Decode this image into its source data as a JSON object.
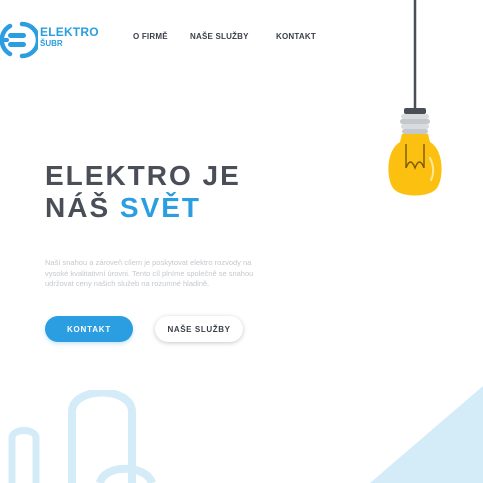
{
  "brand": {
    "line1": "ELEKTRO",
    "line2": "ŠUBR",
    "color": "#2a9ee0"
  },
  "nav": {
    "items": [
      {
        "label": "O FIRMĚ"
      },
      {
        "label": "NAŠE SLUŽBY"
      },
      {
        "label": "KONTAKT"
      }
    ]
  },
  "hero": {
    "title_part1": "ELEKTRO JE",
    "title_part2": "NÁŠ",
    "title_accent": "SVĚT",
    "description": "Naší snahou a zároveň cílem je poskytovat elektro rozvody na vysoké kvalitativní úrovni. Tento cíl plníme společně se snahou udržovat ceny našich služeb na rozumné hladině.",
    "primary_button": "KONTAKT",
    "secondary_button": "NAŠE SLUŽBY"
  },
  "icons": {
    "logo": "plug-logo-icon",
    "bulb": "light-bulb-icon",
    "plug_decoration": "plug-outline-icon"
  },
  "colors": {
    "accent": "#2a9ee0",
    "heading": "#4a4e57",
    "bulb": "#fcc010",
    "decoration": "#d4ebf8"
  }
}
